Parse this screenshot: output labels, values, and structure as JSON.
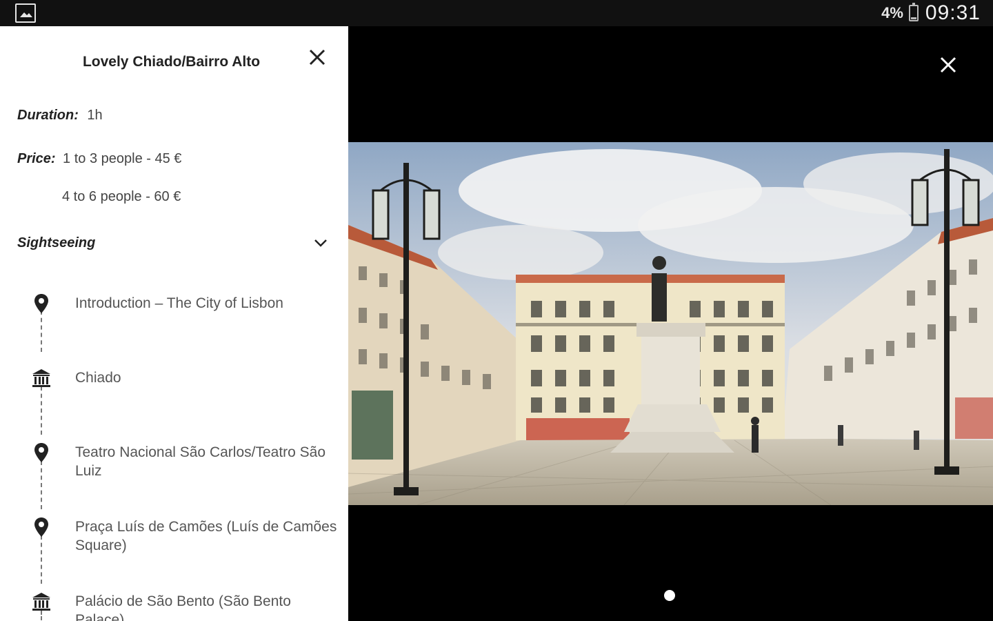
{
  "status_bar": {
    "battery_text": "4%",
    "time": "09:31"
  },
  "panel": {
    "title": "Lovely Chiado/Bairro Alto",
    "duration_label": "Duration:",
    "duration_value": "1h",
    "price_label": "Price:",
    "price_options": [
      "1 to 3 people - 45 €",
      "4 to 6 people - 60 €"
    ],
    "section_label": "Sightseeing",
    "stops": [
      {
        "icon": "location-pin-icon",
        "text": "Introduction – The City of Lisbon"
      },
      {
        "icon": "museum-icon",
        "text": "Chiado"
      },
      {
        "icon": "location-pin-icon",
        "text": "Teatro Nacional São Carlos/Teatro São Luiz"
      },
      {
        "icon": "location-pin-icon",
        "text": "Praça Luís de Camões (Luís de Camões Square)"
      },
      {
        "icon": "museum-icon",
        "text": "Palácio de São Bento (São Bento Palace)"
      }
    ]
  },
  "viewer": {
    "pages": 1,
    "current_page": 1
  },
  "colors": {
    "status_bar_bg": "#111111",
    "panel_bg": "#ffffff",
    "viewer_bg": "#000000"
  }
}
